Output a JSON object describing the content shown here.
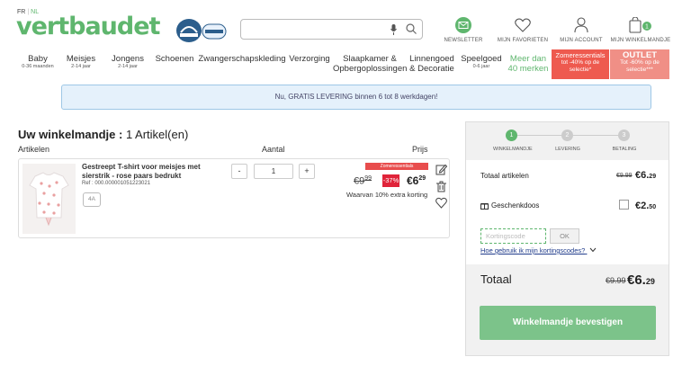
{
  "header": {
    "lang_fr": "FR",
    "lang_nl": "NL",
    "logo": "vertbaudet",
    "search_placeholder": "",
    "icons": [
      {
        "label": "NEWSLETTER",
        "icon": "newsletter-icon"
      },
      {
        "label": "MIJN FAVORIETEN",
        "icon": "heart-icon"
      },
      {
        "label": "MIJN ACCOUNT",
        "icon": "user-icon"
      },
      {
        "label": "MIJN WINKELMANDJE",
        "icon": "bag-icon",
        "count": "1"
      }
    ]
  },
  "nav": {
    "items": [
      {
        "label": "Baby",
        "sub": "0-36 maanden"
      },
      {
        "label": "Meisjes",
        "sub": "2-14 jaar"
      },
      {
        "label": "Jongens",
        "sub": "2-14 jaar"
      },
      {
        "label": "Schoenen",
        "sub": ""
      },
      {
        "label": "Zwangerschapskleding",
        "sub": ""
      },
      {
        "label": "Verzorging",
        "sub": ""
      },
      {
        "label": "Slaapkamer &",
        "label2": "Opbergoplossingen"
      },
      {
        "label": "Linnengoed",
        "label2": "& Decoratie"
      },
      {
        "label": "Speelgoed",
        "sub": "0-6 jaar"
      },
      {
        "label": "Meer dan",
        "label2": "40 merken"
      }
    ],
    "promo": {
      "title": "Zomeressentials",
      "text": "tot -40% op de selectie*"
    },
    "outlet": {
      "title": "OUTLET",
      "text": "Tot -60% op de selectie***"
    }
  },
  "banner": "Nu, GRATIS LEVERING binnen 6 tot 8 werkdagen!",
  "cart": {
    "title_bold": "Uw winkelmandje :",
    "title_rest": "1 Artikel(en)",
    "col_items": "Artikelen",
    "col_qty": "Aantal",
    "col_price": "Prijs",
    "item": {
      "name": "Gestreept T-shirt voor meisjes met sierstrik - rose paars bedrukt",
      "ref": "Ref : 000.000001051223021",
      "size": "4A",
      "qty": "1",
      "minus": "-",
      "plus": "+",
      "sale_tag": "Zomeressentials",
      "old_price": "€9",
      "old_cents": "99",
      "discount": "-37%",
      "price": "€6",
      "price_cents": "29",
      "extra": "Waarvan 10% extra korting"
    }
  },
  "summary": {
    "steps": [
      {
        "num": "1",
        "label": "WINKELMANDJE"
      },
      {
        "num": "2",
        "label": "LEVERING"
      },
      {
        "num": "3",
        "label": "BETALING"
      }
    ],
    "total_items_label": "Totaal artikelen",
    "total_items_old": "€9.99",
    "total_items_price": "€6.",
    "total_items_cents": "29",
    "gift_label": "Geschenkdoos",
    "gift_price": "€2.",
    "gift_cents": "50",
    "coupon_placeholder": "Kortingscode",
    "ok": "OK",
    "codes_link": "Hoe gebruik ik mijn kortingscodes?",
    "total_label": "Totaal",
    "total_old": "€9.99",
    "total_price": "€6.",
    "total_cents": "29",
    "confirm": "Winkelmandje bevestigen"
  },
  "colors": {
    "brand": "#5fb66e",
    "promo": "#ee5a4f",
    "discount": "#e0243a",
    "confirm": "#7cc38a"
  }
}
